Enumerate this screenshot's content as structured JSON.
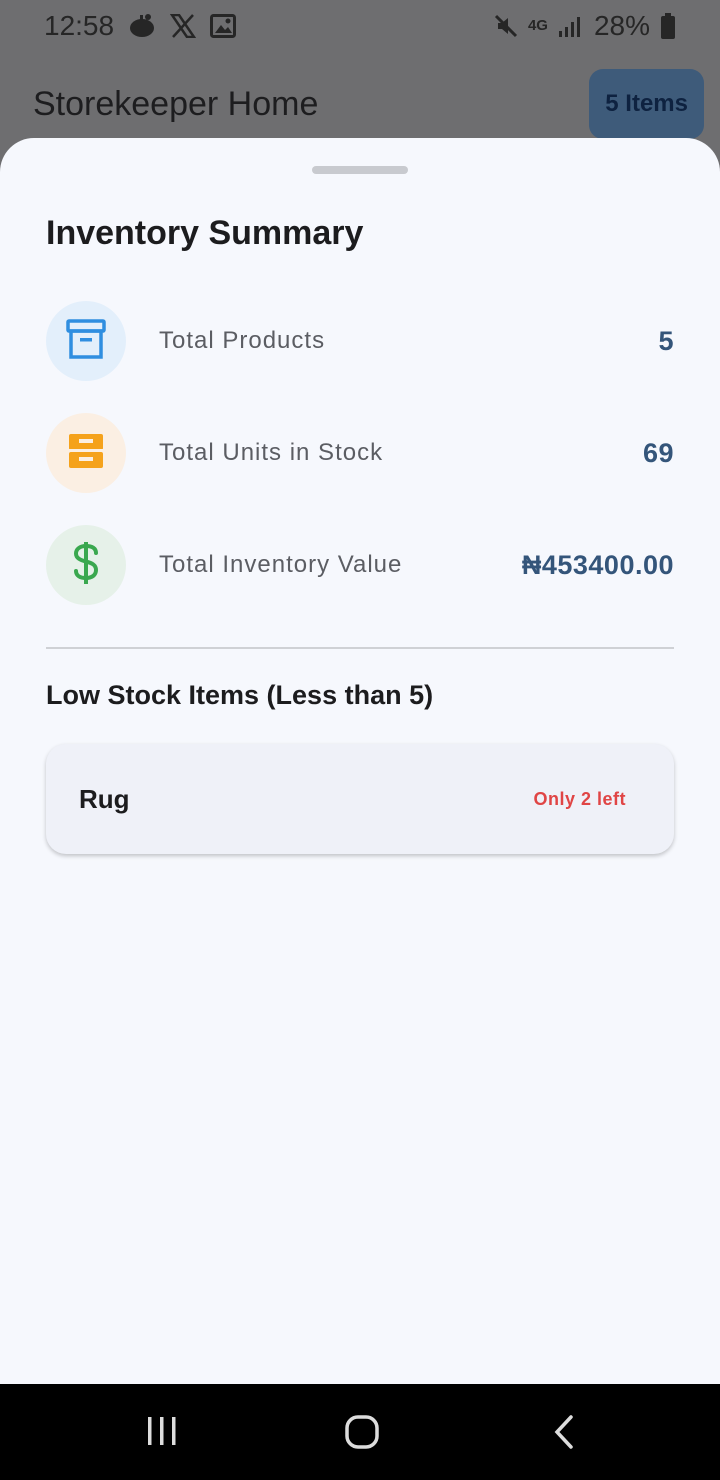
{
  "status_bar": {
    "time": "12:58",
    "network": "4G",
    "battery": "28%",
    "icons": [
      "notification-app-icon",
      "x-icon",
      "gallery-icon",
      "mute-icon",
      "signal-icon",
      "battery-icon"
    ]
  },
  "app": {
    "title": "Storekeeper Home",
    "items_chip": "5 Items"
  },
  "summary": {
    "title": "Inventory Summary",
    "stats": [
      {
        "label": "Total Products",
        "value": "5",
        "icon": "archive-box-icon",
        "icon_color": "#2f8ee0",
        "bg_color": "#e3effb"
      },
      {
        "label": "Total Units in Stock",
        "value": "69",
        "icon": "inventory-icon",
        "icon_color": "#f5a21b",
        "bg_color": "#fbefe3"
      },
      {
        "label": "Total Inventory Value",
        "value": "₦453400.00",
        "icon": "dollar-icon",
        "icon_color": "#3aa84f",
        "bg_color": "#e6f1e9"
      }
    ]
  },
  "low_stock": {
    "title": "Low Stock Items (Less than 5)",
    "items": [
      {
        "name": "Rug",
        "badge": "Only 2 left"
      }
    ]
  },
  "colors": {
    "value_text": "#34557a",
    "warning": "#e04545",
    "sheet_bg": "#f6f8fd"
  }
}
